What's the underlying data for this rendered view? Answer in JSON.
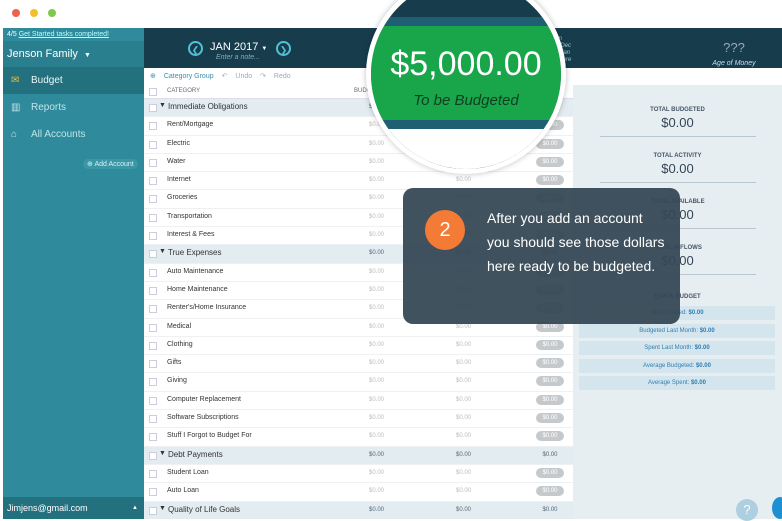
{
  "window": {
    "controls": [
      {
        "name": "close",
        "color": "#f25f4c"
      },
      {
        "name": "minimize",
        "color": "#f6be2c"
      },
      {
        "name": "zoom",
        "color": "#7ec84a"
      }
    ]
  },
  "sidebar": {
    "tasks_count": "4/5",
    "tasks_link": "Get Started tasks completed!",
    "budget_name": "Jenson Family",
    "nav": [
      {
        "label": "Budget",
        "icon": "envelope-icon",
        "glyph": "✉",
        "active": true
      },
      {
        "label": "Reports",
        "icon": "bar-chart-icon",
        "glyph": "▥",
        "active": false
      },
      {
        "label": "All Accounts",
        "icon": "bank-icon",
        "glyph": "⌂",
        "active": false
      }
    ],
    "add_account": "Add Account",
    "user_email": "Jimjens@gmail.com"
  },
  "header": {
    "month": "JAN 2017",
    "note_placeholder": "Enter a note...",
    "side_lines": [
      "ion",
      "in Dec",
      "in Jan",
      "Future"
    ],
    "age_of_money_value": "???",
    "age_of_money_label": "Age of Money"
  },
  "toolbar": {
    "category_group": "Category Group",
    "undo": "Undo",
    "redo": "Redo"
  },
  "table": {
    "headers": {
      "category": "CATEGORY",
      "budgeted": "BUDG",
      "available": "LE"
    },
    "rows": [
      {
        "type": "group",
        "name": "Immediate Obligations",
        "budgeted": "$0.00",
        "activity": "$0.00",
        "available": "$0.00"
      },
      {
        "type": "item",
        "name": "Rent/Mortgage",
        "budgeted": "$0.00",
        "activity": "$0.00",
        "available": "$0.00"
      },
      {
        "type": "item",
        "name": "Electric",
        "budgeted": "$0.00",
        "activity": "$0.00",
        "available": "$0.00"
      },
      {
        "type": "item",
        "name": "Water",
        "budgeted": "$0.00",
        "activity": "$0.00",
        "available": "$0.00"
      },
      {
        "type": "item",
        "name": "Internet",
        "budgeted": "$0.00",
        "activity": "$0.00",
        "available": "$0.00"
      },
      {
        "type": "item",
        "name": "Groceries",
        "budgeted": "$0.00",
        "activity": "$0.00",
        "available": "$0.00"
      },
      {
        "type": "item",
        "name": "Transportation",
        "budgeted": "$0.00",
        "activity": "$0.00",
        "available": "$0.00"
      },
      {
        "type": "item",
        "name": "Interest & Fees",
        "budgeted": "$0.00",
        "activity": "$0.00",
        "available": "$0.00"
      },
      {
        "type": "group",
        "name": "True Expenses",
        "budgeted": "$0.00",
        "activity": "$0.00",
        "available": "$0.00"
      },
      {
        "type": "item",
        "name": "Auto Maintenance",
        "budgeted": "$0.00",
        "activity": "$0.00",
        "available": "$0.00"
      },
      {
        "type": "item",
        "name": "Home Maintenance",
        "budgeted": "$0.00",
        "activity": "$0.00",
        "available": "$0.00"
      },
      {
        "type": "item",
        "name": "Renter's/Home Insurance",
        "budgeted": "$0.00",
        "activity": "$0.00",
        "available": "$0.00"
      },
      {
        "type": "item",
        "name": "Medical",
        "budgeted": "$0.00",
        "activity": "$0.00",
        "available": "$0.00"
      },
      {
        "type": "item",
        "name": "Clothing",
        "budgeted": "$0.00",
        "activity": "$0.00",
        "available": "$0.00"
      },
      {
        "type": "item",
        "name": "Gifts",
        "budgeted": "$0.00",
        "activity": "$0.00",
        "available": "$0.00"
      },
      {
        "type": "item",
        "name": "Giving",
        "budgeted": "$0.00",
        "activity": "$0.00",
        "available": "$0.00"
      },
      {
        "type": "item",
        "name": "Computer Replacement",
        "budgeted": "$0.00",
        "activity": "$0.00",
        "available": "$0.00"
      },
      {
        "type": "item",
        "name": "Software Subscriptions",
        "budgeted": "$0.00",
        "activity": "$0.00",
        "available": "$0.00"
      },
      {
        "type": "item",
        "name": "Stuff I Forgot to Budget For",
        "budgeted": "$0.00",
        "activity": "$0.00",
        "available": "$0.00"
      },
      {
        "type": "group",
        "name": "Debt Payments",
        "budgeted": "$0.00",
        "activity": "$0.00",
        "available": "$0.00"
      },
      {
        "type": "item",
        "name": "Student Loan",
        "budgeted": "$0.00",
        "activity": "$0.00",
        "available": "$0.00"
      },
      {
        "type": "item",
        "name": "Auto Loan",
        "budgeted": "$0.00",
        "activity": "$0.00",
        "available": "$0.00"
      },
      {
        "type": "group",
        "name": "Quality of Life Goals",
        "budgeted": "$0.00",
        "activity": "$0.00",
        "available": "$0.00"
      }
    ]
  },
  "inspector": {
    "stats": [
      {
        "label": "TOTAL BUDGETED",
        "value": "$0.00"
      },
      {
        "label": "TOTAL ACTIVITY",
        "value": "$0.00"
      },
      {
        "label": "TOTAL AVAILABLE",
        "value": "$0.00"
      },
      {
        "label": "TOTAL INFLOWS",
        "value": "$0.00"
      }
    ],
    "quick_budget_title": "QUICK BUDGET",
    "quick_budget": [
      {
        "label": "Underfunded:",
        "value": "$0.00"
      },
      {
        "label": "Budgeted Last Month:",
        "value": "$0.00"
      },
      {
        "label": "Spent Last Month:",
        "value": "$0.00"
      },
      {
        "label": "Average Budgeted:",
        "value": "$0.00"
      },
      {
        "label": "Average Spent:",
        "value": "$0.00"
      }
    ]
  },
  "callout": {
    "amount": "$5,000.00",
    "label": "To be Budgeted",
    "amount_color": "#19a64a"
  },
  "tooltip": {
    "step": "2",
    "text": "After you add an account you should see those dollars here ready to be budgeted.",
    "step_color": "#f47b35"
  },
  "help": "?"
}
